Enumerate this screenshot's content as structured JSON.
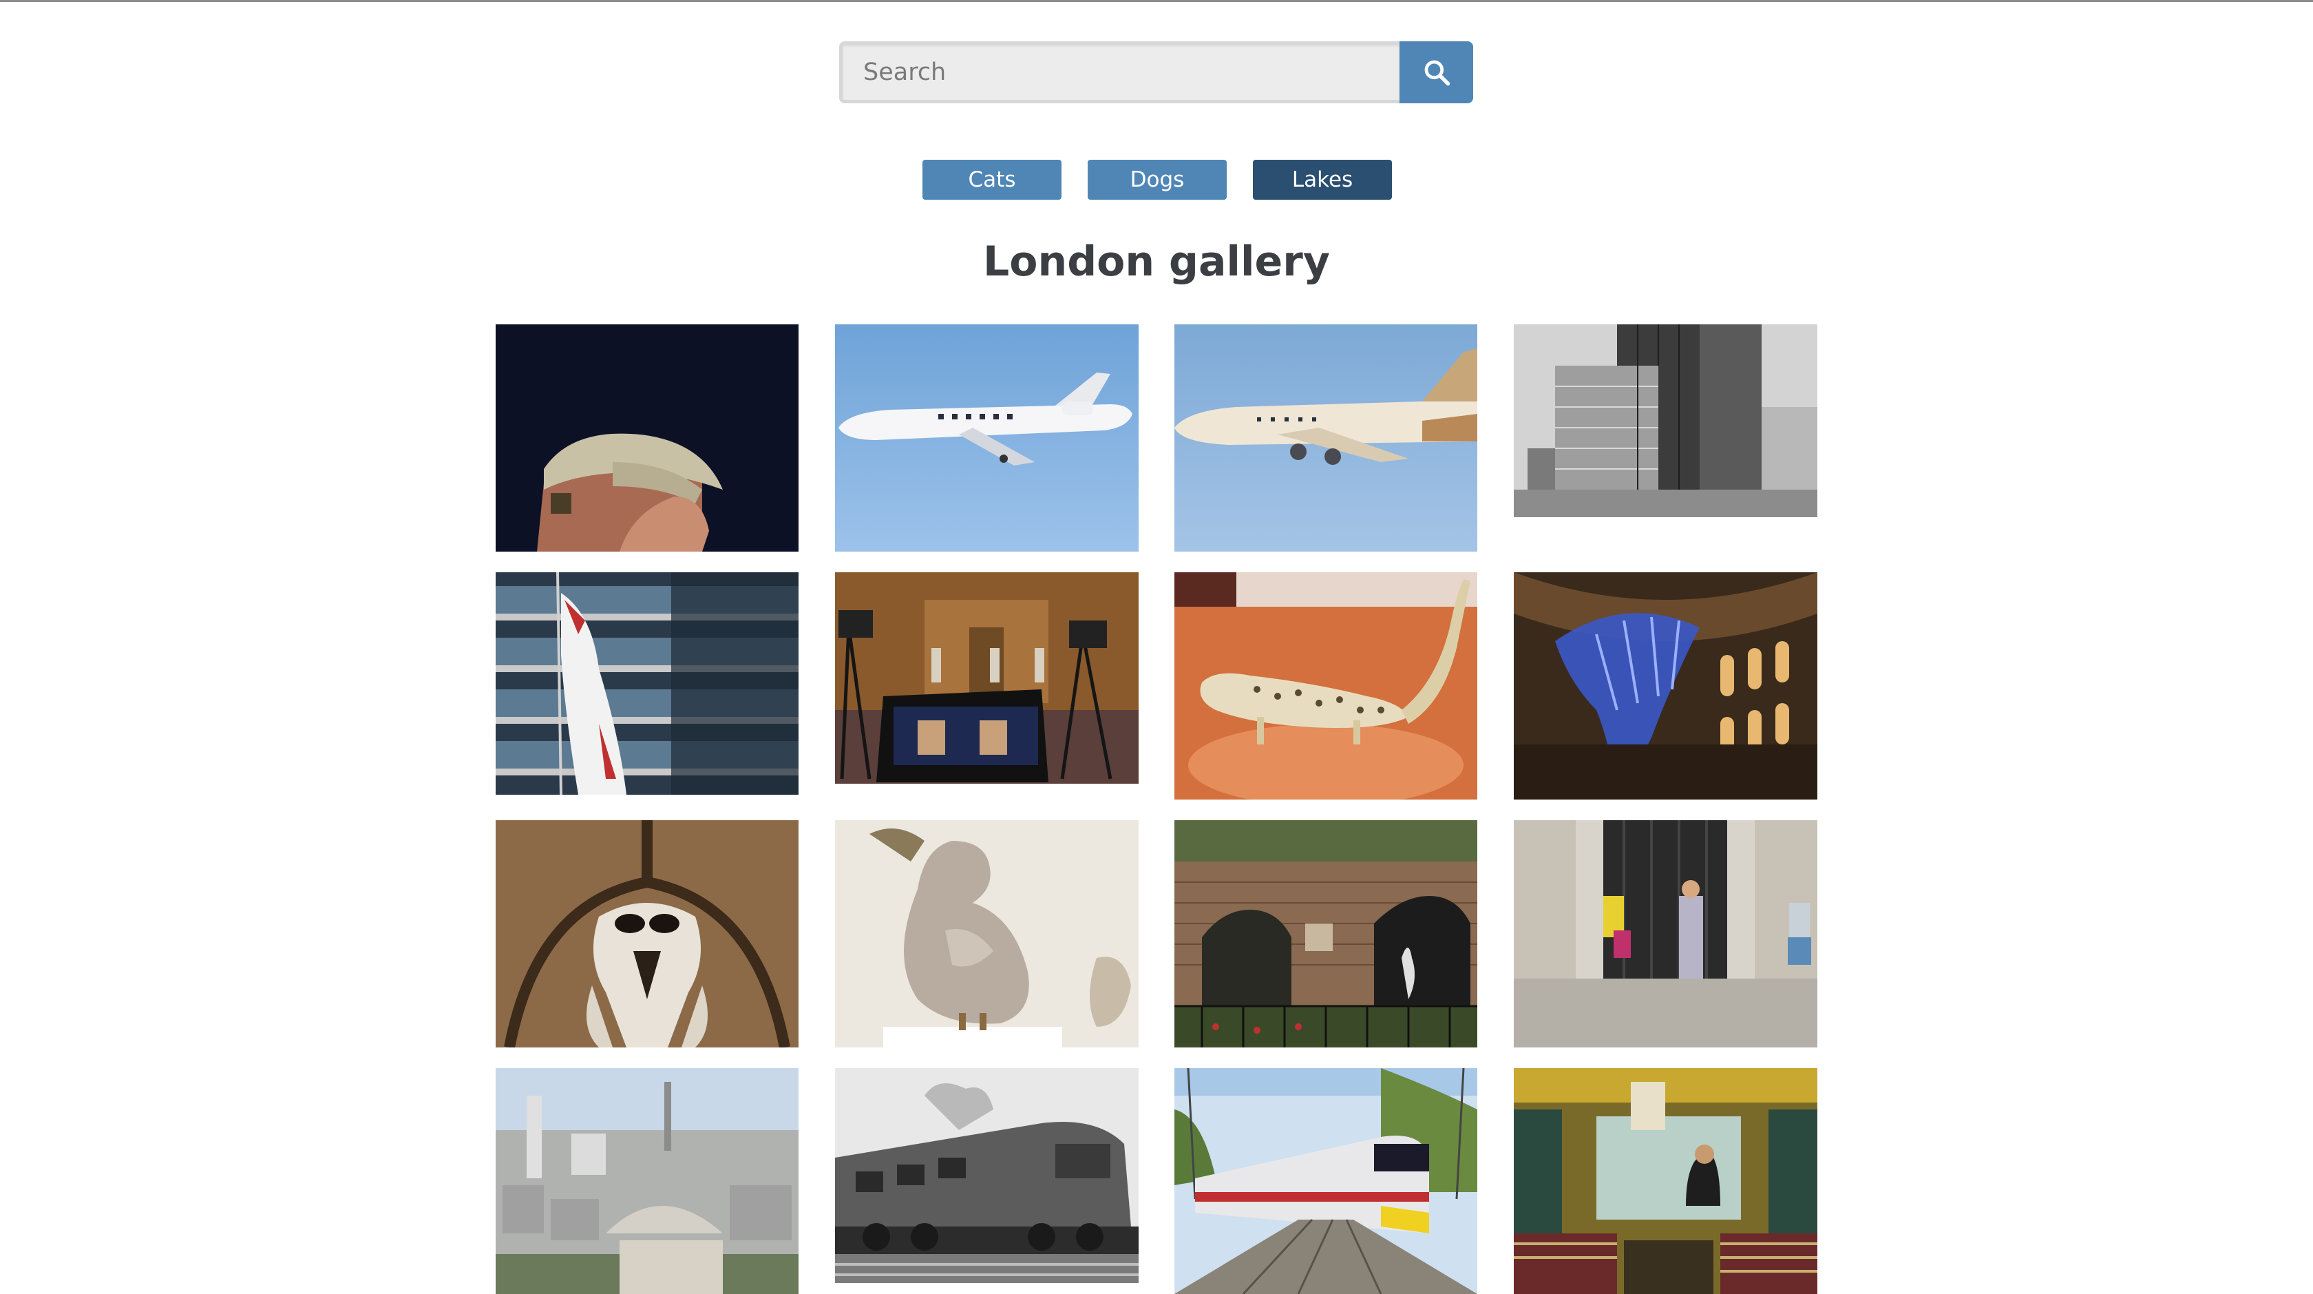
{
  "search": {
    "placeholder": "Search",
    "icon": "search-icon"
  },
  "categories": [
    {
      "label": "Cats",
      "active": false
    },
    {
      "label": "Dogs",
      "active": false
    },
    {
      "label": "Lakes",
      "active": true
    }
  ],
  "gallery": {
    "title": "London gallery",
    "images": [
      {
        "subject": "man-in-cap-photo"
      },
      {
        "subject": "business-jet-photo"
      },
      {
        "subject": "etihad-airliner-photo"
      },
      {
        "subject": "tower-blocks-bw-photo"
      },
      {
        "subject": "flag-and-apartments-photo"
      },
      {
        "subject": "press-conference-photo"
      },
      {
        "subject": "stuffed-genet-photo"
      },
      {
        "subject": "whale-skeleton-museum-photo"
      },
      {
        "subject": "elephant-skull-photo"
      },
      {
        "subject": "dodo-model-photo"
      },
      {
        "subject": "brick-wall-graffiti-photo"
      },
      {
        "subject": "tourists-at-gate-photo"
      },
      {
        "subject": "london-skyline-photo"
      },
      {
        "subject": "diesel-locomotive-bw-photo"
      },
      {
        "subject": "passenger-train-photo"
      },
      {
        "subject": "tram-interior-photo"
      }
    ]
  }
}
